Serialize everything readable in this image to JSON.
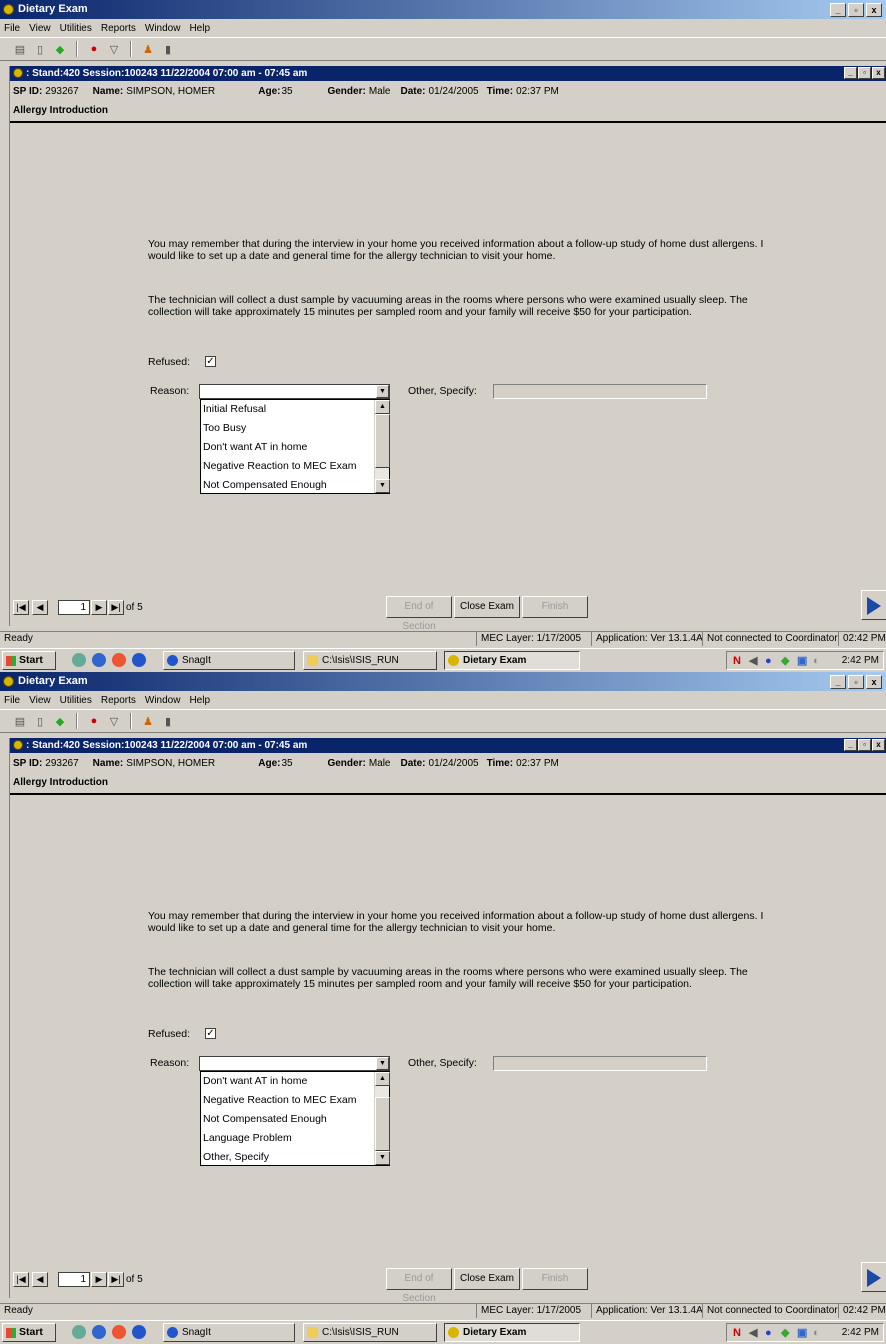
{
  "window": {
    "title": "Dietary Exam",
    "min": "_",
    "max": "▫",
    "close": "x"
  },
  "menu": [
    "File",
    "View",
    "Utilities",
    "Reports",
    "Window",
    "Help"
  ],
  "child_window": {
    "title": ": Stand:420 Session:100243 11/22/2004 07:00 am - 07:45 am"
  },
  "participant": {
    "sp_id_label": "SP ID:",
    "sp_id": "293267",
    "name_label": "Name:",
    "name": "SIMPSON, HOMER",
    "age_label": "Age:",
    "age": "35",
    "gender_label": "Gender:",
    "gender": "Male",
    "date_label": "Date:",
    "date": "01/24/2005",
    "time_label": "Time:",
    "time": "02:37 PM"
  },
  "section_title": "Allergy Introduction",
  "paragraph1": "You may remember that during the interview in your home you received information about a follow-up study of home dust allergens.  I would like to set up a date and general time for the allergy technician to visit your home.",
  "paragraph2": "The technician will collect a dust sample by vacuuming areas in the rooms where persons who were examined usually sleep.  The collection will take approximately 15 minutes per sampled room and your family will receive $50 for your participation.",
  "refused": {
    "label": "Refused:",
    "checked": "✓"
  },
  "reason": {
    "label": "Reason:",
    "value": ""
  },
  "other_specify": {
    "label": "Other, Specify:",
    "value": ""
  },
  "dropdown_top": [
    "Initial Refusal",
    "Too Busy",
    "Don't want AT in home",
    "Negative Reaction to MEC Exam",
    "Not Compensated Enough"
  ],
  "dropdown_bottom": [
    "Don't want AT in home",
    "Negative Reaction to MEC Exam",
    "Not Compensated Enough",
    "Language Problem",
    "Other, Specify"
  ],
  "nav": {
    "page": "1",
    "of_label": "of 5",
    "end_of_section": "End of Section",
    "close_exam": "Close Exam",
    "finish": "Finish"
  },
  "status": {
    "ready": "Ready",
    "mec_layer": "MEC Layer: 1/17/2005",
    "application": "Application: Ver 13.1.4A",
    "coordinator": "Not connected to Coordinator",
    "time": "02:42 PM"
  },
  "taskbar": {
    "start": "Start",
    "items": [
      "SnagIt",
      "C:\\Isis\\ISIS_RUN",
      "Dietary Exam"
    ],
    "clock": "2:42 PM"
  },
  "colors": {
    "title_blue": "#0a246a",
    "face": "#d4d0c8",
    "accent_arrow": "#1a4aa8"
  }
}
